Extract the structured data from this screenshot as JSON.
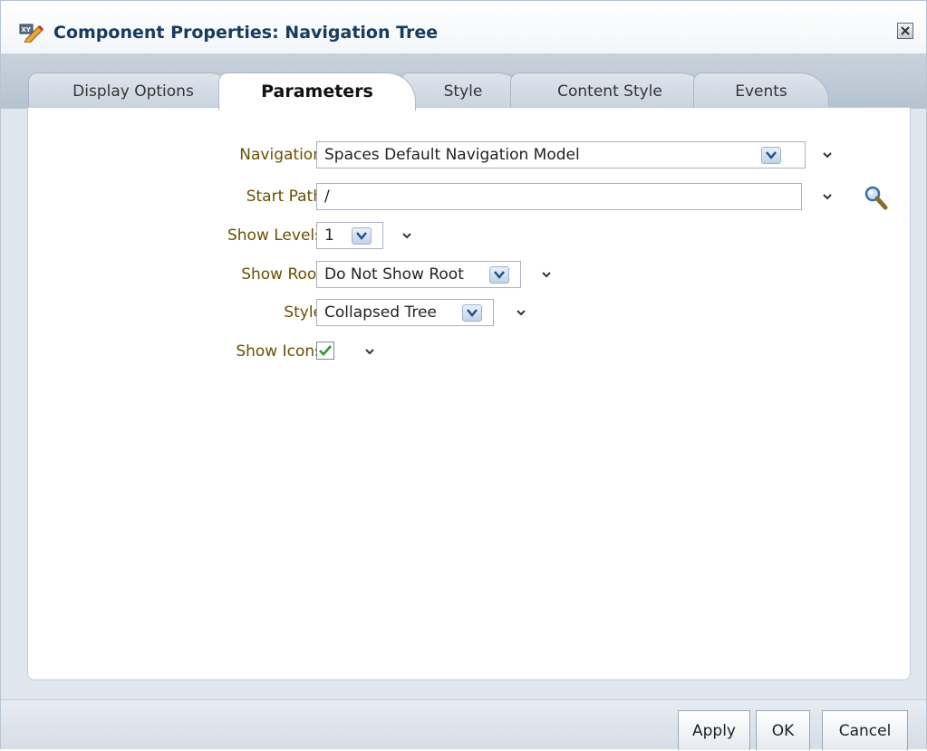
{
  "dialog": {
    "title": "Component Properties: Navigation Tree",
    "title_icon": "edit-properties-icon",
    "close_icon": "close-icon"
  },
  "tabs": [
    {
      "label": "Display Options",
      "active": false
    },
    {
      "label": "Parameters",
      "active": true
    },
    {
      "label": "Style",
      "active": false
    },
    {
      "label": "Content Style",
      "active": false
    },
    {
      "label": "Events",
      "active": false
    }
  ],
  "form": {
    "navigation": {
      "label": "Navigation",
      "value": "Spaces Default Navigation Model"
    },
    "start_path": {
      "label": "Start Path",
      "value": "/"
    },
    "show_levels": {
      "label": "Show Levels",
      "value": "1"
    },
    "show_root": {
      "label": "Show Root",
      "value": "Do Not Show Root"
    },
    "style": {
      "label": "Style",
      "value": "Collapsed Tree"
    },
    "show_icons": {
      "label": "Show Icons",
      "checked": true
    }
  },
  "footer": {
    "apply_label": "Apply",
    "ok_label": "OK",
    "cancel_label": "Cancel"
  },
  "colors": {
    "label_text": "#6b4f00",
    "title_text": "#173b61",
    "checkmark": "#2a9a2a"
  }
}
